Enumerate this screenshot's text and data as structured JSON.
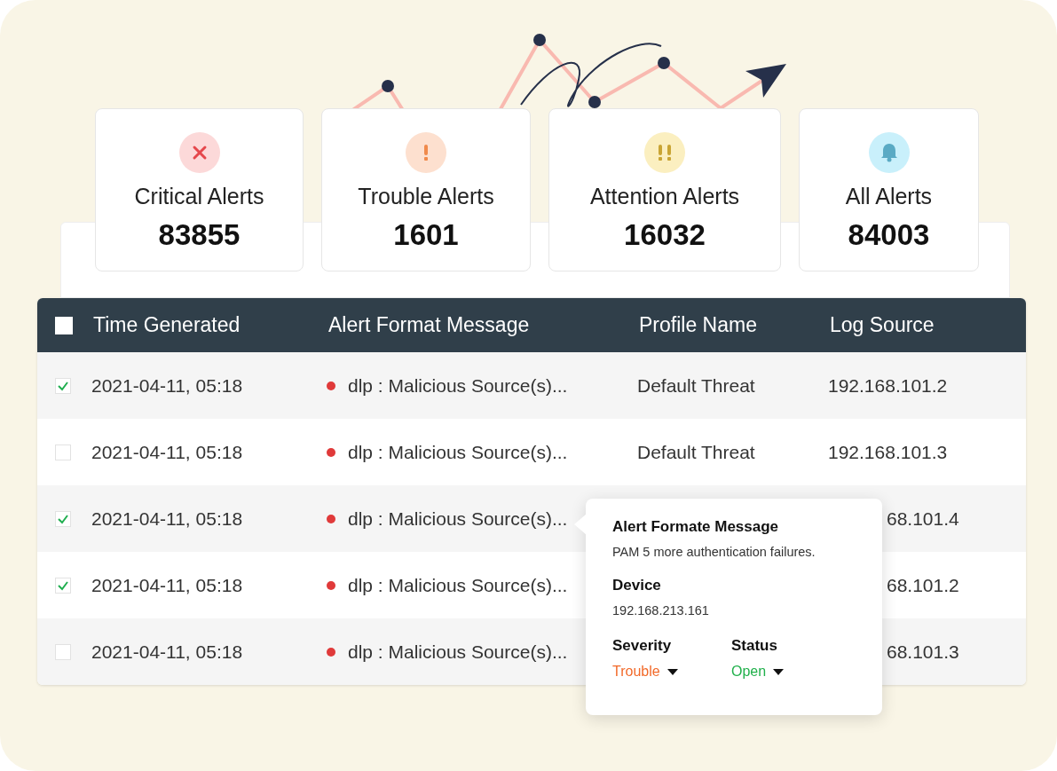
{
  "summary_cards": [
    {
      "kind": "critical",
      "label": "Critical Alerts",
      "count": "83855"
    },
    {
      "kind": "trouble",
      "label": "Trouble Alerts",
      "count": "1601"
    },
    {
      "kind": "attention",
      "label": "Attention Alerts",
      "count": "16032"
    },
    {
      "kind": "all",
      "label": "All Alerts",
      "count": "84003"
    }
  ],
  "table": {
    "select_all": {
      "checked": false
    },
    "columns": [
      "Time Generated",
      "Alert Format Message",
      "Profile Name",
      "Log Source"
    ],
    "rows": [
      {
        "checked": true,
        "time": "2021-04-11, 05:18",
        "message": "dlp : Malicious Source(s)...",
        "profile": "Default Threat",
        "log_source": "192.168.101.2"
      },
      {
        "checked": false,
        "time": "2021-04-11, 05:18",
        "message": "dlp : Malicious Source(s)...",
        "profile": "Default Threat",
        "log_source": "192.168.101.3"
      },
      {
        "checked": true,
        "time": "2021-04-11, 05:18",
        "message": "dlp : Malicious Source(s)...",
        "log_source": "68.101.4"
      },
      {
        "checked": true,
        "time": "2021-04-11, 05:18",
        "message": "dlp : Malicious Source(s)...",
        "log_source": "68.101.2"
      },
      {
        "checked": false,
        "time": "2021-04-11, 05:18",
        "message": "dlp : Malicious Source(s)...",
        "log_source": "68.101.3"
      }
    ]
  },
  "popover": {
    "message_label": "Alert Formate Message",
    "message": "PAM 5 more authentication failures.",
    "device_label": "Device",
    "device": "192.168.213.161",
    "severity_label": "Severity",
    "severity": "Trouble",
    "status_label": "Status",
    "status": "Open"
  }
}
